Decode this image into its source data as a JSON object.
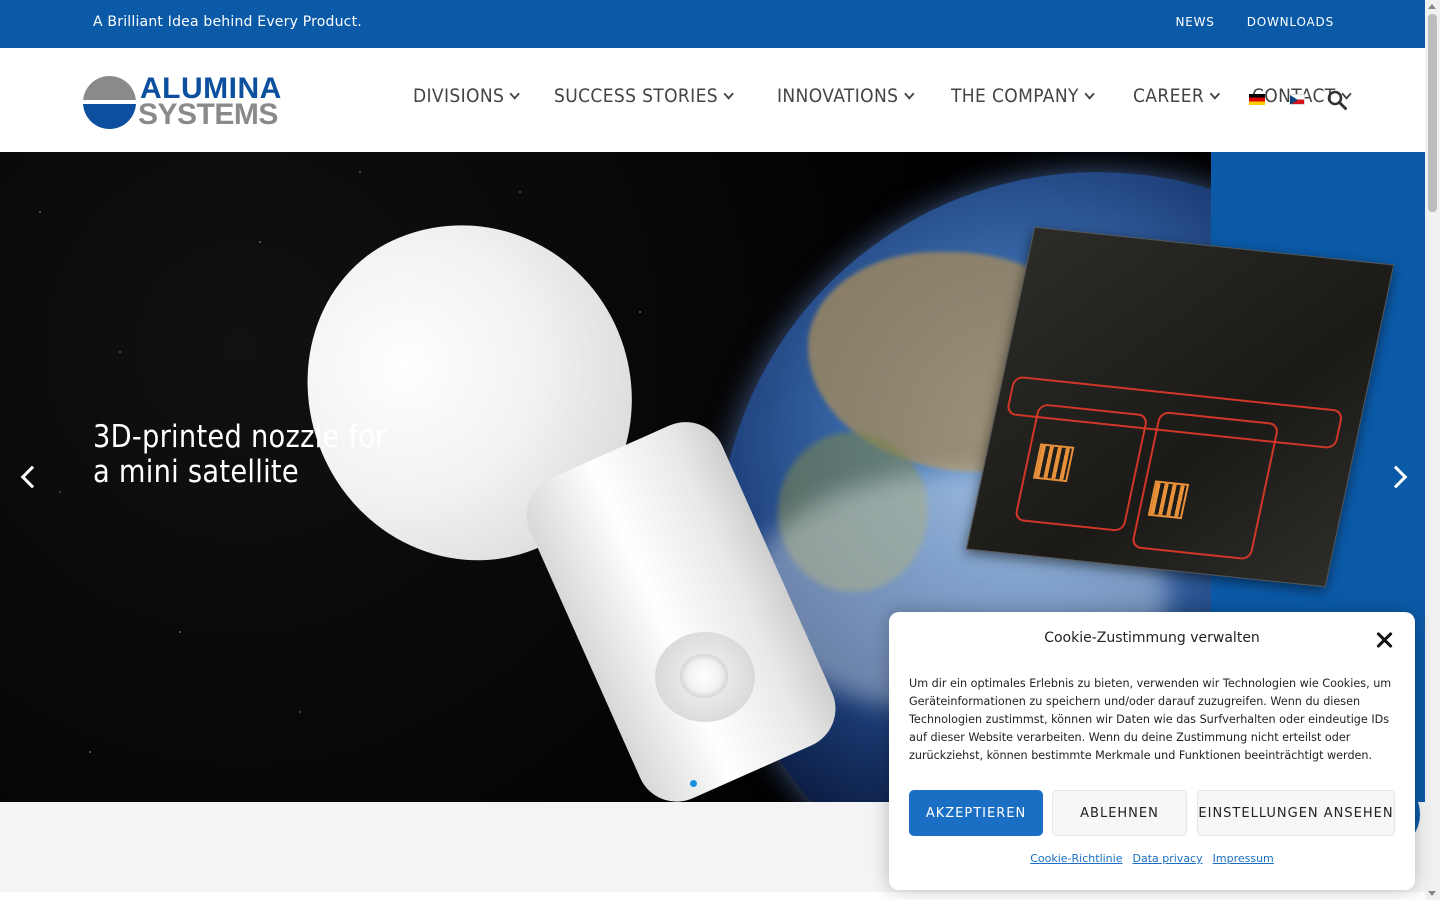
{
  "topbar": {
    "tagline": "A Brilliant Idea behind Every Product.",
    "links": [
      "NEWS",
      "DOWNLOADS"
    ],
    "color": "#0b5aa8"
  },
  "logo": {
    "line1": "ALUMINA",
    "line2": "SYSTEMS"
  },
  "nav": {
    "items": [
      "DIVISIONS",
      "SUCCESS STORIES",
      "INNOVATIONS",
      "THE COMPANY",
      "CAREER",
      "CONTACT"
    ],
    "languages": [
      "de-flag-icon",
      "cz-flag-icon"
    ],
    "search_icon": "search-icon"
  },
  "hero": {
    "title_line1": "3D-printed nozzle for",
    "title_line2": "a mini satellite",
    "slide_indicator": "1"
  },
  "cookie": {
    "title": "Cookie-Zustimmung verwalten",
    "text": "Um dir ein optimales Erlebnis zu bieten, verwenden wir Technologien wie Cookies, um Geräteinformationen zu speichern und/oder darauf zuzugreifen. Wenn du diesen Technologien zustimmst, können wir Daten wie das Surfverhalten oder eindeutige IDs auf dieser Website verarbeiten. Wenn du deine Zustimmung nicht erteilst oder zurückziehst, können bestimmte Merkmale und Funktionen beeinträchtigt werden.",
    "accept": "AKZEPTIEREN",
    "deny": "ABLEHNEN",
    "settings": "EINSTELLUNGEN ANSEHEN",
    "links": [
      "Cookie-Richtlinie",
      "Data privacy",
      "Impressum"
    ],
    "accent": "#1a6fc4"
  }
}
